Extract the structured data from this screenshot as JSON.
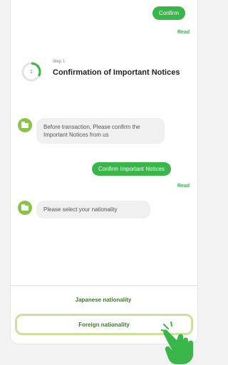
{
  "chat": {
    "confirm_bubble": "Confirm",
    "read_1": "Read",
    "step_label": "Step 1",
    "step_title": "Confirmation of Important Notices",
    "msg_1": "Before transaction, Please confirm the Important Notices from us",
    "confirm_notices_bubble": "Confirm Important Notices",
    "read_2": "Read",
    "msg_2": "Please select your nationality"
  },
  "options": {
    "japanese": "Japanese nationality",
    "foreign": "Foreign nationality"
  },
  "colors": {
    "accent": "#39b54a",
    "avatar": "#8bc34a",
    "highlight_border": "#c9e39a"
  }
}
